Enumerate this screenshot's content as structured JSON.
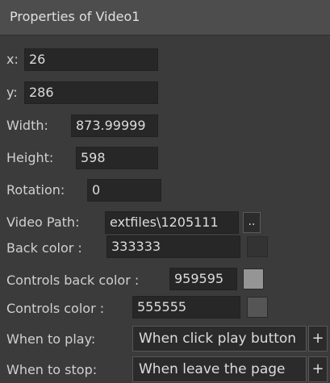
{
  "panel": {
    "title": "Properties of Video1"
  },
  "fields": {
    "x": {
      "label": "x:",
      "value": "26"
    },
    "y": {
      "label": "y:",
      "value": "286"
    },
    "width": {
      "label": "Width:",
      "value": "873.99999"
    },
    "height": {
      "label": "Height:",
      "value": "598"
    },
    "rotation": {
      "label": "Rotation:",
      "value": "0"
    },
    "video_path": {
      "label": "Video Path:",
      "value": "extfiles\\1205111",
      "browse_label": ".."
    },
    "back_color": {
      "label": "Back color :",
      "value": "333333",
      "swatch": "#333333"
    },
    "controls_back_color": {
      "label": "Controls back color :",
      "value": "959595",
      "swatch": "#959595"
    },
    "controls_color": {
      "label": "Controls color :",
      "value": "555555",
      "swatch": "#555555"
    },
    "when_to_play": {
      "label": "When to play:",
      "value": "When click play button",
      "add_label": "+"
    },
    "when_to_stop": {
      "label": "When to stop:",
      "value": "When leave the page",
      "add_label": "+"
    }
  }
}
